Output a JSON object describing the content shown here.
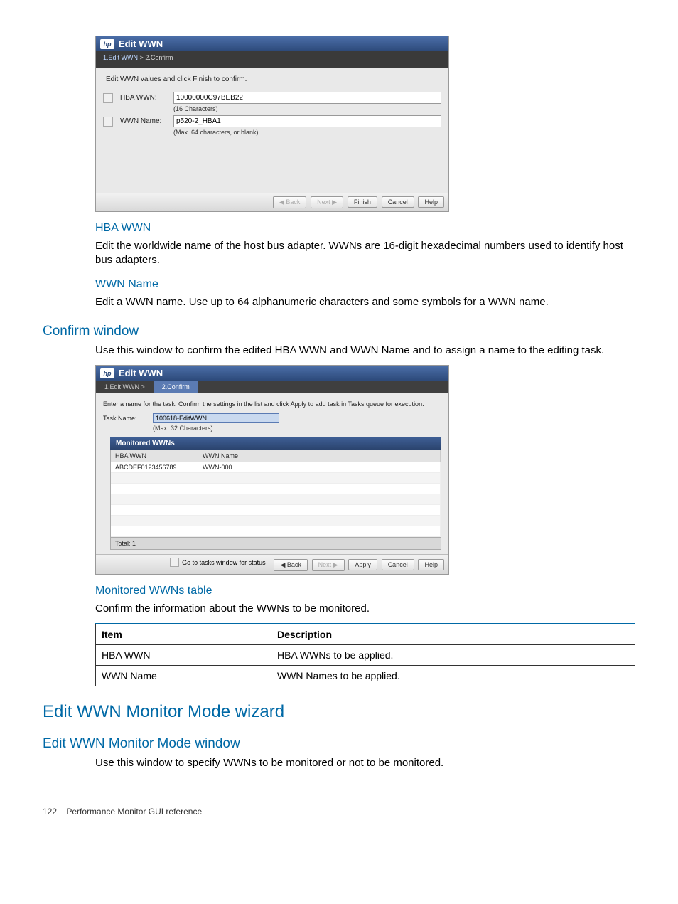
{
  "dialog1": {
    "title": "Edit WWN",
    "step1": "1.Edit WWN",
    "sep": ">",
    "step2": "2.Confirm",
    "instruction": "Edit WWN values and click Finish to confirm.",
    "hba_label": "HBA WWN:",
    "hba_value": "10000000C97BEB22",
    "hba_hint": "(16 Characters)",
    "wname_label": "WWN Name:",
    "wname_value": "p520-2_HBA1",
    "wname_hint": "(Max. 64 characters, or blank)",
    "btn_back": "◀ Back",
    "btn_next": "Next ▶",
    "btn_finish": "Finish",
    "btn_cancel": "Cancel",
    "btn_help": "Help"
  },
  "sec_hba": {
    "heading": "HBA WWN",
    "text": "Edit the worldwide name of the host bus adapter. WWNs are 16-digit hexadecimal numbers used to identify host bus adapters."
  },
  "sec_wname": {
    "heading": "WWN Name",
    "text": "Edit a WWN name. Use up to 64 alphanumeric characters and some symbols for a WWN name."
  },
  "sec_confirm": {
    "heading": "Confirm window",
    "text": "Use this window to confirm the edited HBA WWN and WWN Name and to assign a name to the editing task."
  },
  "dialog2": {
    "title": "Edit WWN",
    "tab1": "1.Edit WWN >",
    "tab2": "2.Confirm",
    "instruction": "Enter a name for the task. Confirm the settings in the list and click Apply to add task in Tasks queue for execution.",
    "taskname_label": "Task Name:",
    "taskname_value": "100618-EditWWN",
    "taskname_hint": "(Max. 32 Characters)",
    "table_title": "Monitored WWNs",
    "col1": "HBA WWN",
    "col2": "WWN Name",
    "row1_c1": "ABCDEF0123456789",
    "row1_c2": "WWN-000",
    "total": "Total: 1",
    "go_tasks": "Go to tasks window for status",
    "btn_back": "◀ Back",
    "btn_next": "Next ▶",
    "btn_apply": "Apply",
    "btn_cancel": "Cancel",
    "btn_help": "Help"
  },
  "sec_monitored": {
    "heading": "Monitored WWNs table",
    "text": "Confirm the information about the WWNs to be monitored."
  },
  "def_table": {
    "h1": "Item",
    "h2": "Description",
    "r1c1": "HBA WWN",
    "r1c2": "HBA WWNs to be applied.",
    "r2c1": "WWN Name",
    "r2c2": "WWN Names to be applied."
  },
  "sec_wizard": {
    "heading": "Edit WWN Monitor Mode wizard"
  },
  "sec_window": {
    "heading": "Edit WWN Monitor Mode window",
    "text": "Use this window to specify WWNs to be monitored or not to be monitored."
  },
  "footer": {
    "page": "122",
    "title": "Performance Monitor GUI reference"
  }
}
